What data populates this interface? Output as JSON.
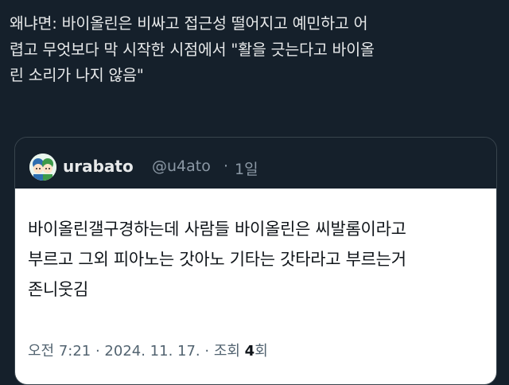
{
  "tweet": {
    "lines": [
      "왜냐면: 바이올린은 비싸고 접근성 떨어지고 예민하고 어",
      "렵고 무엇보다 막 시작한 시점에서 \"활을 긋는다고 바이올",
      "린 소리가 나지 않음\""
    ]
  },
  "quote": {
    "author_name": "urabato",
    "author_handle": "@u4ato",
    "separator": "·",
    "time_ago": "1일",
    "lines": [
      "바이올린갤구경하는데 사람들 바이올린은 씨발롬이라고",
      "부르고 그외 피아노는 갓아노 기타는 갓타라고 부르는거",
      "존니웃김"
    ],
    "meta": {
      "timestamp": "오전 7:21 · 2024. 11. 17. · 조회 ",
      "views_number": "4",
      "views_suffix": "회"
    },
    "avatar_icon": "chibi-character-avatar"
  },
  "colors": {
    "background": "#15202b",
    "text_primary": "#e7e9ea",
    "text_secondary": "#8b98a5",
    "border": "#38444d",
    "card_body": "#ffffff"
  }
}
